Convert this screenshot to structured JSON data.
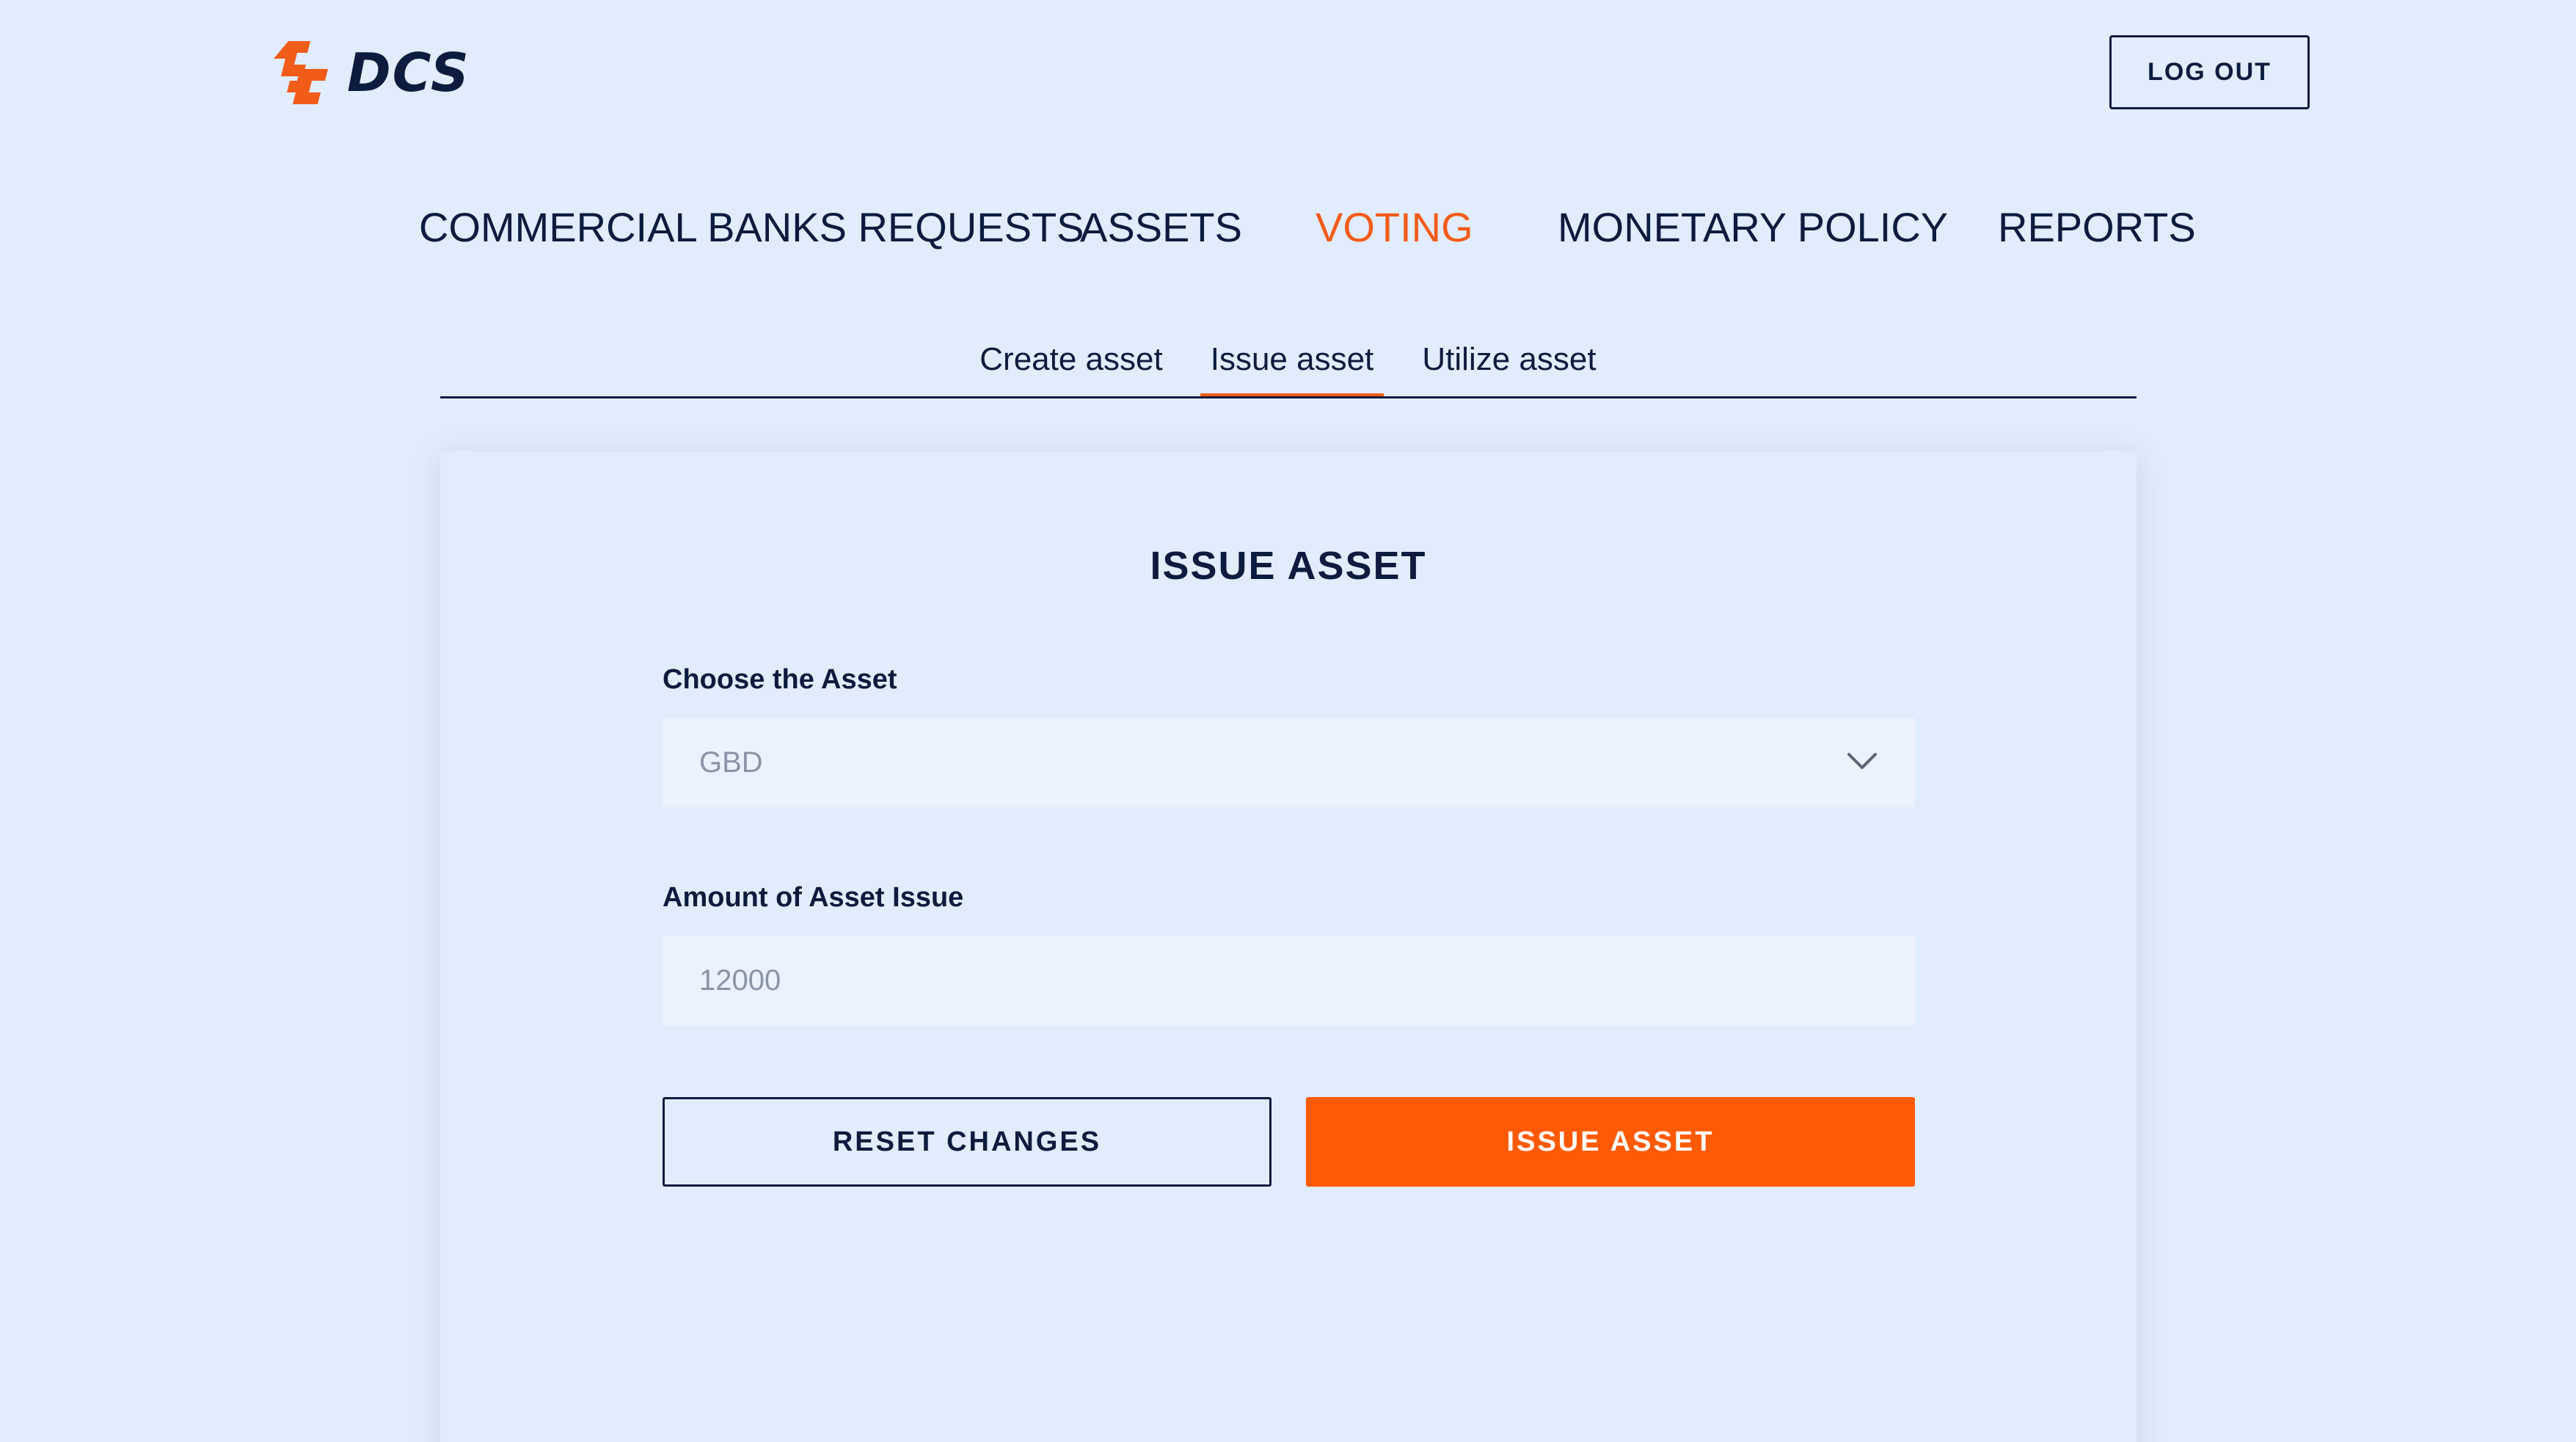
{
  "brand": {
    "name": "DCS",
    "logo_icon": "dcs-logo-icon",
    "accent_color": "#f25c19",
    "text_color": "#0d1b3e"
  },
  "header": {
    "logout_label": "LOG OUT"
  },
  "main_nav": {
    "items": [
      {
        "label": "COMMERCIAL BANKS REQUESTS",
        "active": false
      },
      {
        "label": "ASSETS",
        "active": false
      },
      {
        "label": "VOTING",
        "active": true
      },
      {
        "label": "MONETARY POLICY",
        "active": false
      },
      {
        "label": "REPORTS",
        "active": false
      }
    ]
  },
  "sub_tabs": {
    "items": [
      {
        "label": "Create asset",
        "active": false
      },
      {
        "label": "Issue asset",
        "active": true
      },
      {
        "label": "Utilize asset",
        "active": false
      }
    ]
  },
  "form": {
    "title": "ISSUE ASSET",
    "asset_label": "Choose the Asset",
    "asset_value": "GBD",
    "amount_label": "Amount of Asset Issue",
    "amount_value": "12000",
    "reset_label": "RESET CHANGES",
    "submit_label": "ISSUE ASSET",
    "submit_color": "#fe5a04"
  }
}
